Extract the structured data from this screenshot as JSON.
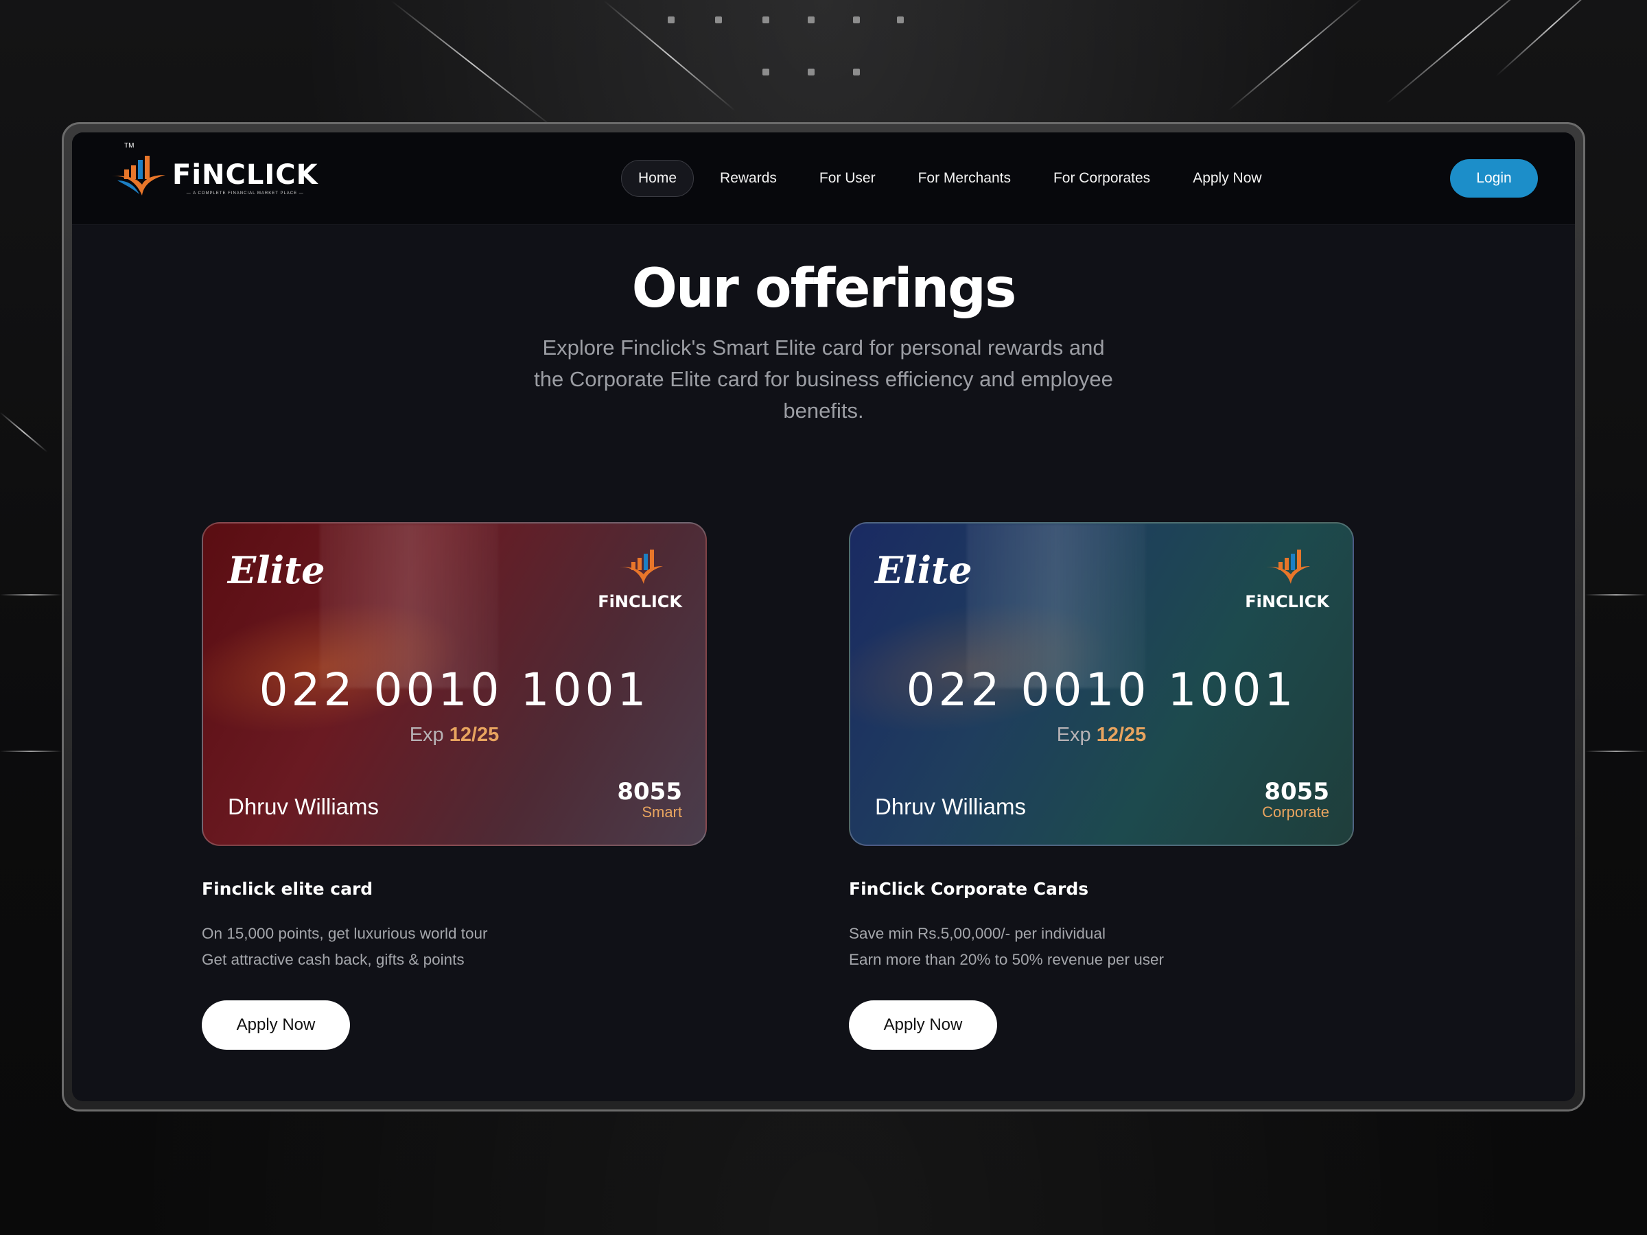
{
  "brand": {
    "name": "FiNCLICK",
    "tagline": "— A COMPLETE FINANCIAL MARKET PLACE —",
    "trademark": "TM"
  },
  "nav": {
    "items": [
      {
        "label": "Home",
        "active": true
      },
      {
        "label": "Rewards",
        "active": false
      },
      {
        "label": "For User",
        "active": false
      },
      {
        "label": "For Merchants",
        "active": false
      },
      {
        "label": "For Corporates",
        "active": false
      },
      {
        "label": "Apply Now",
        "active": false
      }
    ],
    "login_label": "Login"
  },
  "hero": {
    "title": "Our offerings",
    "subtitle": "Explore Finclick's Smart Elite card for personal rewards and the Corporate Elite card for business efficiency and employee benefits."
  },
  "offers": [
    {
      "card": {
        "brand": "Elite",
        "logo_text": "FiNCLICK",
        "number": "022 0010 1001",
        "exp_label": "Exp",
        "exp_value": "12/25",
        "holder": "Dhruv Williams",
        "code": "8055",
        "tier": "Smart"
      },
      "title": "Finclick elite card",
      "lines": [
        "On 15,000 points, get luxurious world tour",
        "Get attractive cash back, gifts & points"
      ],
      "button": "Apply Now"
    },
    {
      "card": {
        "brand": "Elite",
        "logo_text": "FiNCLICK",
        "number": "022 0010 1001",
        "exp_label": "Exp",
        "exp_value": "12/25",
        "holder": "Dhruv Williams",
        "code": "8055",
        "tier": "Corporate"
      },
      "title": "FinClick Corporate Cards",
      "lines": [
        "Save min Rs.5,00,000/- per individual",
        "Earn more than 20% to 50% revenue per user"
      ],
      "button": "Apply Now"
    }
  ],
  "colors": {
    "accent": "#1c8ec9",
    "orange": "#e8a45f",
    "background": "#101117"
  }
}
